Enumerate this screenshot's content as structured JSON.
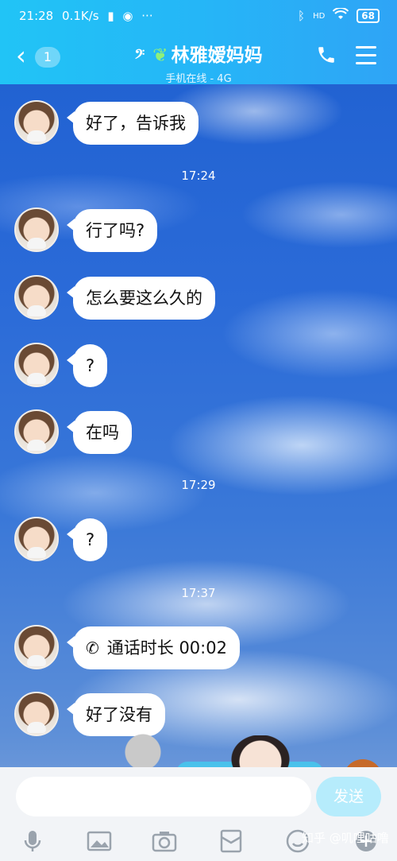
{
  "status_bar": {
    "time": "21:28",
    "speed": "0.1K/s",
    "battery": "68",
    "more": "···",
    "wifi": "HD"
  },
  "header": {
    "back_count": "1",
    "title": "林雅嫒妈妈",
    "subtitle": "手机在线 - 4G"
  },
  "messages": [
    {
      "text": "好了，告诉我"
    },
    {
      "text": "行了吗?"
    },
    {
      "text": "怎么要这么久的"
    },
    {
      "text": "?"
    },
    {
      "text": "在吗"
    },
    {
      "text": "?"
    },
    {
      "text": "通话时长 00:02"
    },
    {
      "text": "好了没有"
    }
  ],
  "timestamps": [
    "17:24",
    "17:29",
    "17:37"
  ],
  "input": {
    "placeholder": "",
    "send_label": "发送"
  },
  "watermark": "知乎 @叽哩咕噜",
  "colors": {
    "header_start": "#21c4f6",
    "header_end": "#2fa4f6",
    "send_disabled": "#b6ecfc"
  }
}
